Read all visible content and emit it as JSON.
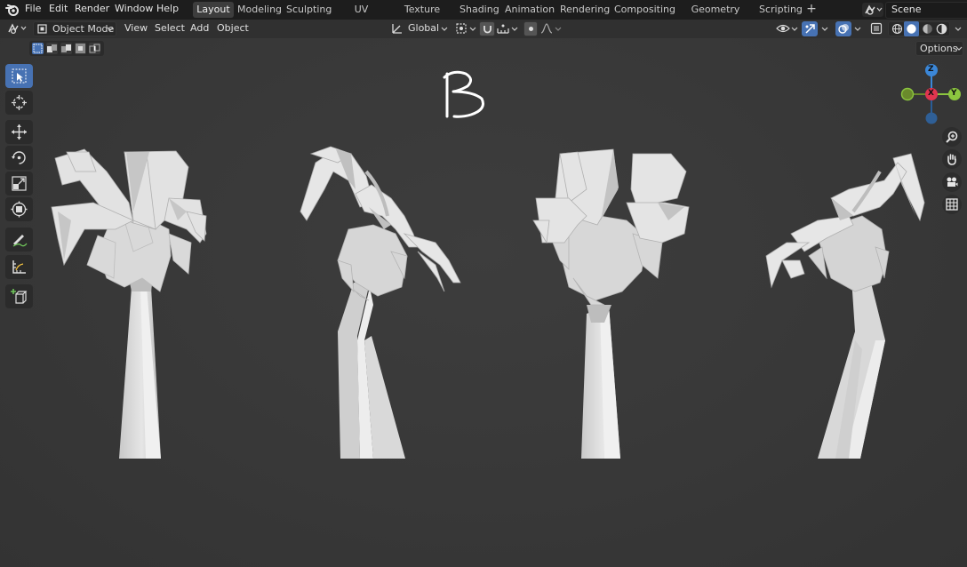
{
  "app": {
    "name": "Blender",
    "scene_name": "Scene"
  },
  "menu": [
    {
      "label": "File"
    },
    {
      "label": "Edit"
    },
    {
      "label": "Render"
    },
    {
      "label": "Window"
    },
    {
      "label": "Help"
    }
  ],
  "workspaces": [
    {
      "label": "Layout",
      "active": true
    },
    {
      "label": "Modeling"
    },
    {
      "label": "Sculpting"
    },
    {
      "label": "UV Editing"
    },
    {
      "label": "Texture Paint"
    },
    {
      "label": "Shading"
    },
    {
      "label": "Animation"
    },
    {
      "label": "Rendering"
    },
    {
      "label": "Compositing"
    },
    {
      "label": "Geometry Nodes"
    },
    {
      "label": "Scripting"
    }
  ],
  "add_workspace": "+",
  "header": {
    "mode": "Object Mode",
    "menus": [
      "View",
      "Select",
      "Add",
      "Object"
    ],
    "transform_orientation": "Global",
    "options_label": "Options"
  },
  "gizmo": {
    "z": "Z",
    "x": "X",
    "y": "Y"
  },
  "annotation": {
    "text": "B"
  },
  "toolbar_tools": [
    "select-box",
    "cursor",
    "move",
    "rotate",
    "scale",
    "transform",
    "annotate",
    "measure",
    "add-cube"
  ],
  "colors": {
    "accent": "#4772b3",
    "x_axis": "#e0354f",
    "y_axis": "#8cc63f",
    "z_axis": "#3b87d8",
    "model": "#d8d8d8"
  }
}
